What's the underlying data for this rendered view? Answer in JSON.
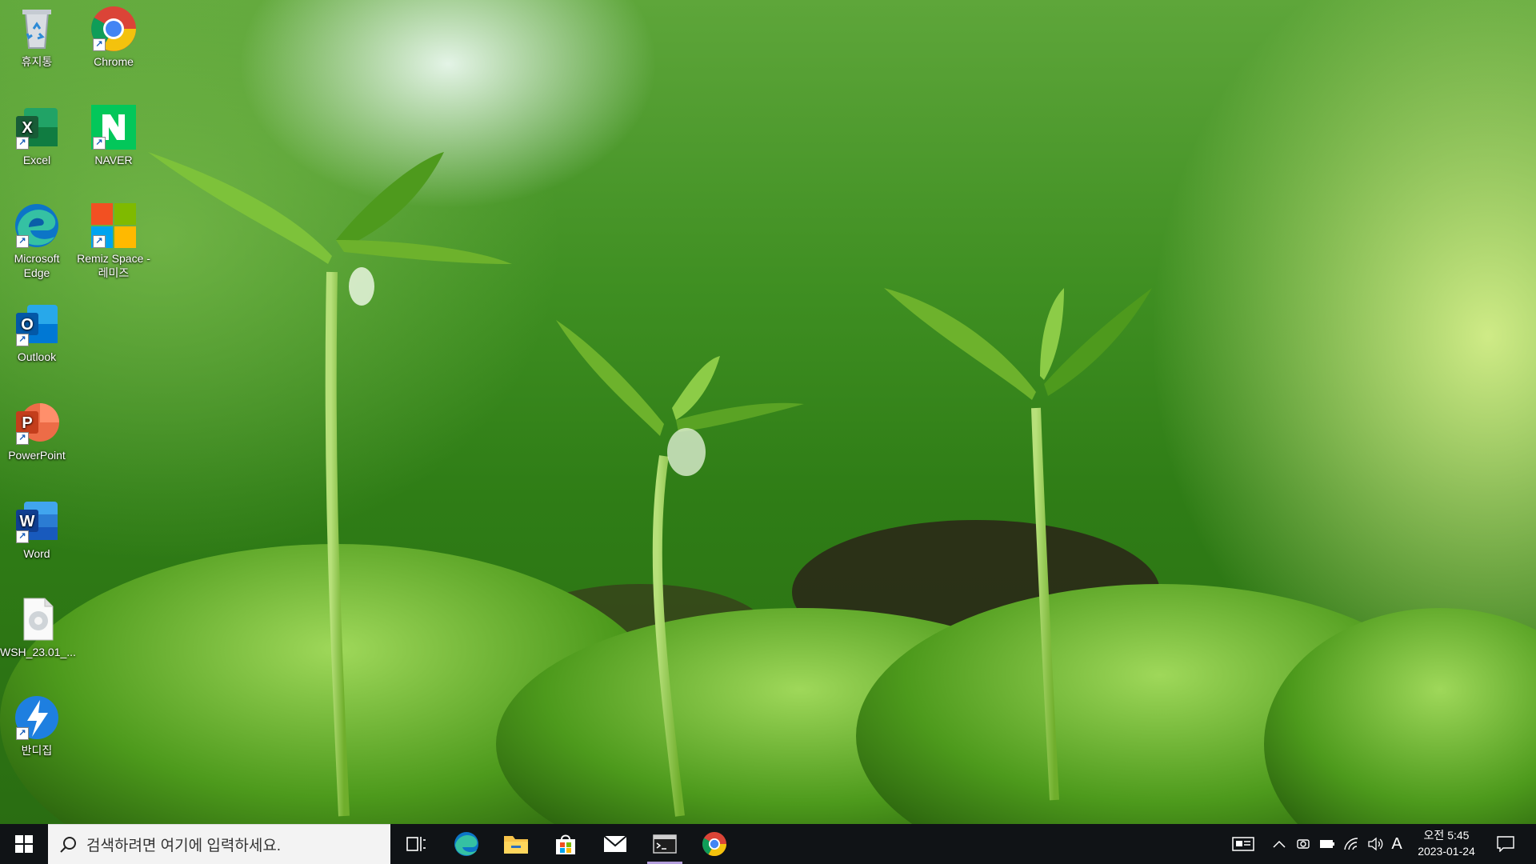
{
  "desktop": {
    "icons": [
      {
        "label": "휴지통",
        "icon": "recycle-bin-icon"
      },
      {
        "label": "Chrome",
        "icon": "chrome-icon"
      },
      {
        "label": "Excel",
        "icon": "excel-icon"
      },
      {
        "label": "NAVER",
        "icon": "naver-icon"
      },
      {
        "label": "Microsoft Edge",
        "icon": "edge-icon"
      },
      {
        "label": "Remiz Space - 레미즈",
        "icon": "remiz-space-icon"
      },
      {
        "label": "Outlook",
        "icon": "outlook-icon"
      },
      {
        "label": "PowerPoint",
        "icon": "powerpoint-icon"
      },
      {
        "label": "Word",
        "icon": "word-icon"
      },
      {
        "label": "WSH_23.01_...",
        "icon": "file-icon"
      },
      {
        "label": "반디집",
        "icon": "bandizip-icon"
      }
    ]
  },
  "taskbar": {
    "start_icon": "windows-start-icon",
    "search_placeholder": "검색하려면 여기에 입력하세요.",
    "pinned": [
      {
        "name": "Task View",
        "icon": "task-view-icon"
      },
      {
        "name": "Microsoft Edge",
        "icon": "edge-icon"
      },
      {
        "name": "File Explorer",
        "icon": "folder-icon"
      },
      {
        "name": "Microsoft Store",
        "icon": "store-icon"
      },
      {
        "name": "Mail",
        "icon": "mail-icon"
      },
      {
        "name": "Terminal",
        "icon": "terminal-icon",
        "active": true
      },
      {
        "name": "Chrome",
        "icon": "chrome-icon"
      }
    ],
    "tray": {
      "input_mode": "A",
      "time": "오전 5:45",
      "date": "2023-01-24"
    }
  },
  "colors": {
    "taskbar_bg": "#101316",
    "search_bg": "#f3f3f3",
    "active_indicator": "#b39ddb"
  }
}
